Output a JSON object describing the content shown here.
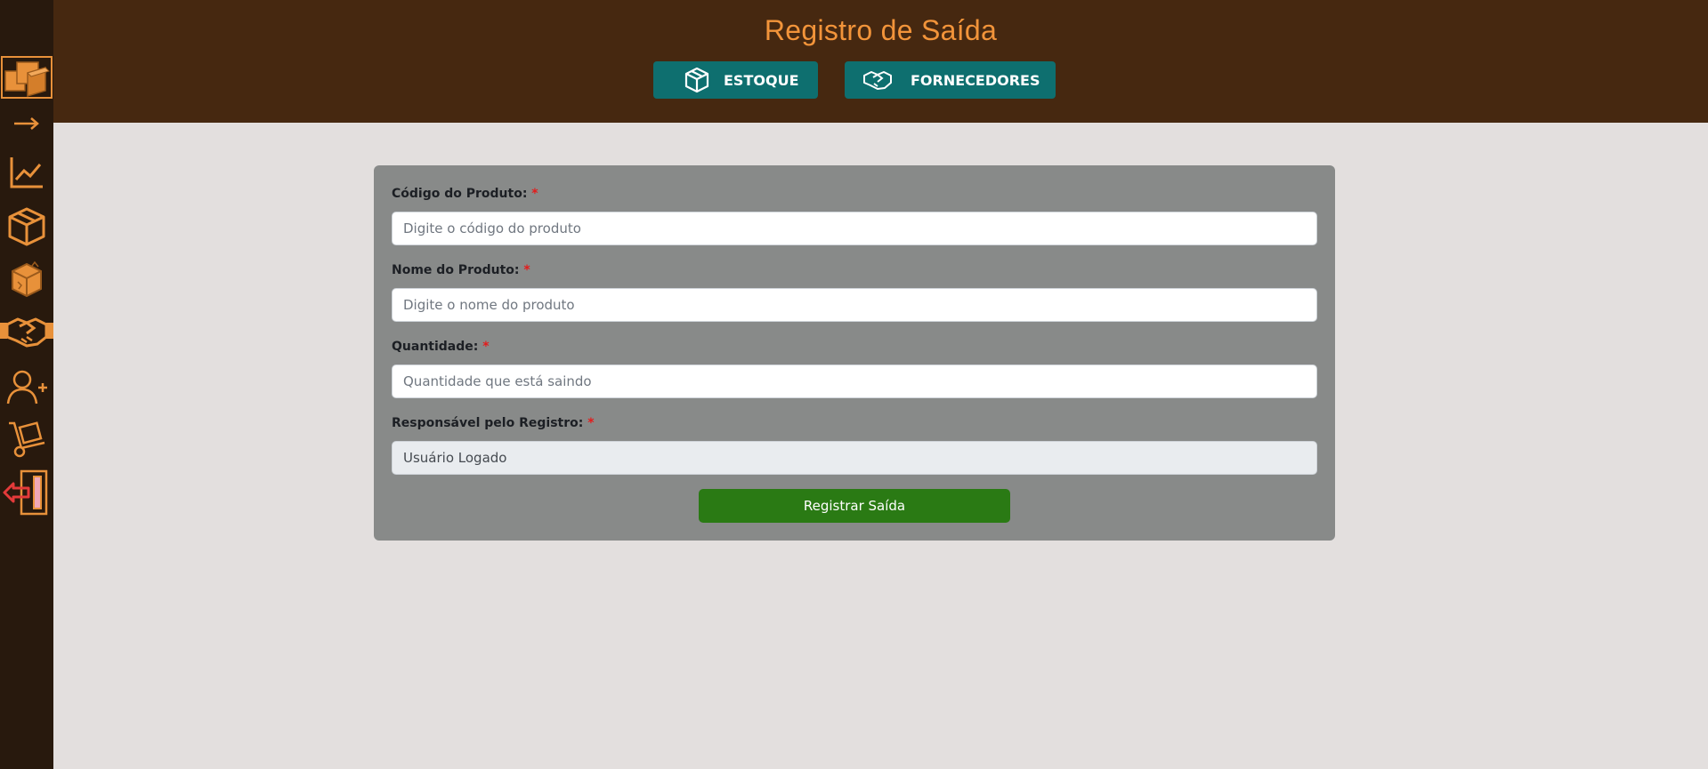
{
  "header": {
    "title": "Registro de Saída",
    "nav": [
      {
        "label": "ESTOQUE",
        "icon": "box-icon"
      },
      {
        "label": "FORNECEDORES",
        "icon": "handshake-icon"
      }
    ]
  },
  "sidebar": {
    "items": [
      {
        "icon": "boxes-logo-icon"
      },
      {
        "icon": "arrow-right-icon"
      },
      {
        "icon": "line-chart-icon"
      },
      {
        "icon": "box-icon"
      },
      {
        "icon": "broken-box-icon"
      },
      {
        "icon": "handshake-icon"
      },
      {
        "icon": "add-user-icon"
      },
      {
        "icon": "hand-truck-icon"
      },
      {
        "icon": "logout-icon"
      }
    ]
  },
  "form": {
    "codigo": {
      "label": "Código do Produto:",
      "required_mark": "*",
      "placeholder": "Digite o código do produto",
      "value": ""
    },
    "nome": {
      "label": "Nome do Produto:",
      "required_mark": "*",
      "placeholder": "Digite o nome do produto",
      "value": ""
    },
    "quantidade": {
      "label": "Quantidade:",
      "required_mark": "*",
      "placeholder": "Quantidade que está saindo",
      "value": ""
    },
    "responsavel": {
      "label": "Responsável pelo Registro:",
      "required_mark": "*",
      "value": "Usuário Logado"
    },
    "submit_label": "Registrar Saída"
  },
  "colors": {
    "sidebar_bg": "#28190d",
    "header_bg": "#462810",
    "accent": "#f2943a",
    "nav_button": "#0e6f6f",
    "card_bg": "#888a89",
    "submit_button": "#2a7a14",
    "page_bg": "#e3dfde"
  }
}
